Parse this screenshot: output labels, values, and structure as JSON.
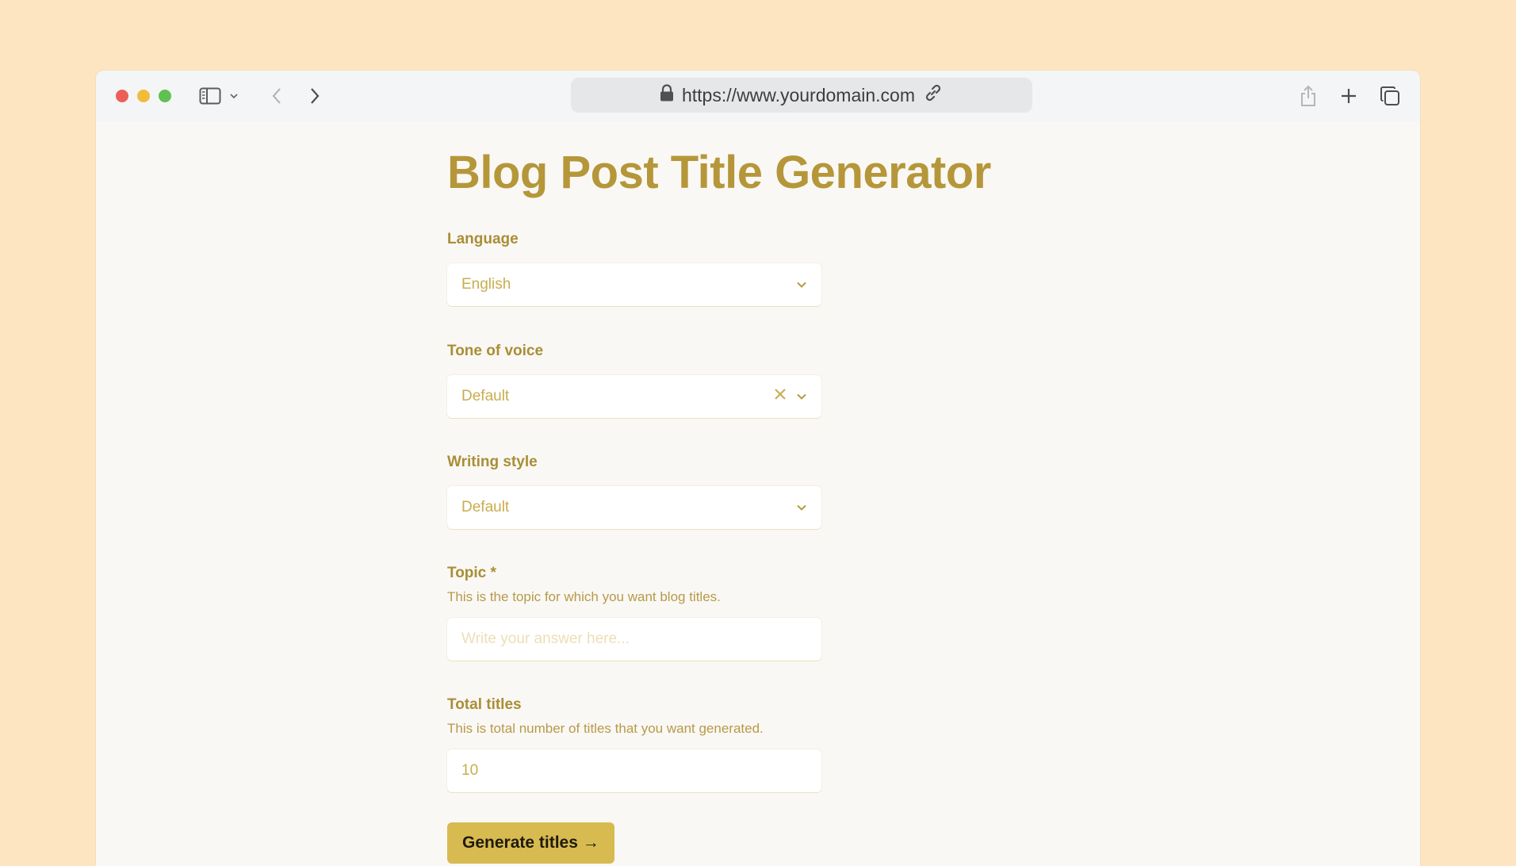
{
  "browser": {
    "url": "https://www.yourdomain.com"
  },
  "page": {
    "title": "Blog Post Title Generator"
  },
  "form": {
    "language": {
      "label": "Language",
      "value": "English"
    },
    "tone": {
      "label": "Tone of voice",
      "value": "Default"
    },
    "style": {
      "label": "Writing style",
      "value": "Default"
    },
    "topic": {
      "label": "Topic *",
      "help": "This is the topic for which you want blog titles.",
      "placeholder": "Write your answer here..."
    },
    "total": {
      "label": "Total titles",
      "help": "This is total number of titles that you want generated.",
      "value": "10"
    },
    "submit_label": "Generate titles →"
  },
  "colors": {
    "background": "#fce5c0",
    "accent": "#b5973a",
    "button": "#d7bb51"
  },
  "icons": [
    "close-window",
    "minimize-window",
    "maximize-window",
    "sidebar-icon",
    "chevron-down-icon",
    "back-icon",
    "forward-icon",
    "lock-icon",
    "link-icon",
    "share-icon",
    "plus-icon",
    "tabs-icon",
    "clear-icon"
  ]
}
